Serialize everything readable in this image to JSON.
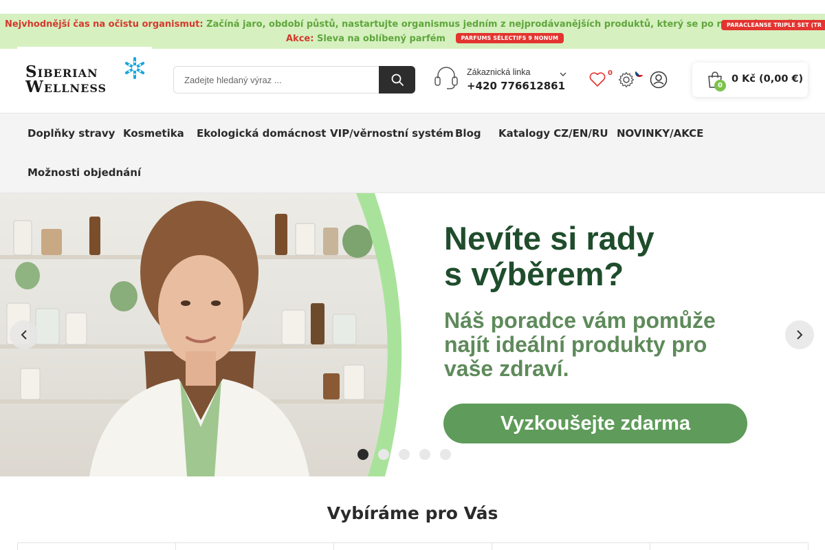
{
  "promo": {
    "line1_red": "Nejvhodnější čas na očistu organismut:",
    "line1_green": "Začíná jaro, období půstů, nastartujte organismus  jedním z nejprodávanějších produktů, který se po roce vrátil na český trh",
    "line1_badge": "PARACLEANSE TRIPLE SET (TR",
    "line2_red": "Akce:",
    "line2_green": "Sleva na oblíbený parfém",
    "line2_badge": "PARFUMS SÉLECTIFS 9 NONUM"
  },
  "brand": {
    "line1": "Siberian",
    "line2": "Wellness",
    "star_color": "#1aa6d9"
  },
  "search": {
    "placeholder": "Zadejte hledaný výraz ..."
  },
  "hotline": {
    "label": "Zákaznická linka",
    "number": "+420 776612861"
  },
  "header_icons": {
    "wishlist_count": "0",
    "cart_count": "0",
    "cart_total": "0 Kč (0,00 €)",
    "language": "CZ"
  },
  "nav": {
    "items": [
      "Doplňky stravy",
      "Kosmetika",
      "Ekologická domácnost",
      "VIP/věrnostní systém",
      "Blog",
      "Katalogy CZ/EN/RU",
      "NOVINKY/AKCE",
      "Možnosti objednání"
    ]
  },
  "hero": {
    "headline_1": "Nevíte si rady",
    "headline_2": "s výběrem?",
    "sub_1": "Náš poradce vám pomůže",
    "sub_2": "najít ideální produkty pro",
    "sub_3": "vaše zdraví.",
    "cta": "Vyzkoušejte zdarma",
    "slide_count": 5,
    "active_slide": 1,
    "accent_green": "#5f9b5a",
    "headline_color": "#1f4d2c"
  },
  "section": {
    "title": "Vybíráme pro Vás"
  }
}
